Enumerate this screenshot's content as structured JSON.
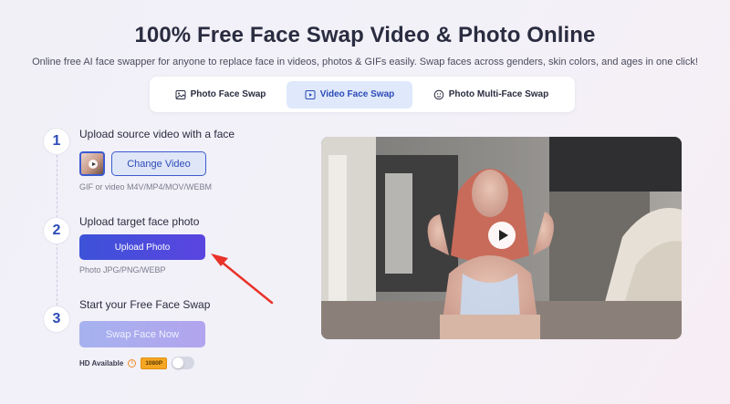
{
  "header": {
    "title": "100% Free Face Swap Video & Photo Online",
    "subtitle": "Online free AI face swapper for anyone to replace face in videos, photos & GIFs easily. Swap faces across genders, skin colors, and ages in one click!"
  },
  "tabs": [
    {
      "label": "Photo Face Swap",
      "icon": "image-icon",
      "active": false
    },
    {
      "label": "Video Face Swap",
      "icon": "video-icon",
      "active": true
    },
    {
      "label": "Photo Multi-Face Swap",
      "icon": "multi-face-icon",
      "active": false
    }
  ],
  "steps": [
    {
      "number": "1",
      "title": "Upload source video with a face",
      "button": "Change Video",
      "hint": "GIF or video M4V/MP4/MOV/WEBM"
    },
    {
      "number": "2",
      "title": "Upload target face photo",
      "button": "Upload Photo",
      "hint": "Photo JPG/PNG/WEBP"
    },
    {
      "number": "3",
      "title": "Start your Free Face Swap",
      "button": "Swap Face Now"
    }
  ],
  "hd": {
    "label": "HD Available",
    "badge": "1080P",
    "enabled": false
  },
  "colors": {
    "accent": "#3b5bd0",
    "upload_btn": "#4a4cdc",
    "badge": "#f5a623",
    "arrow": "#e8322a"
  }
}
